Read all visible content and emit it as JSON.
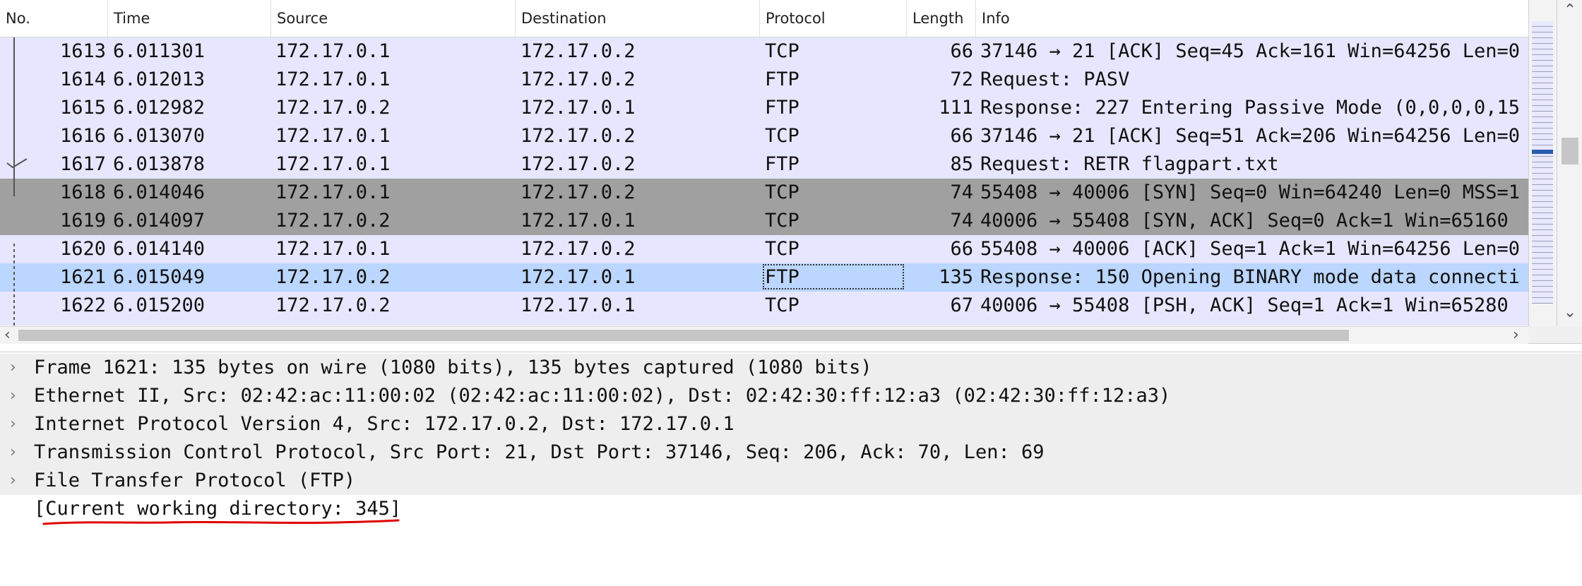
{
  "columns": {
    "no": "No.",
    "time": "Time",
    "source": "Source",
    "destination": "Destination",
    "protocol": "Protocol",
    "length": "Length",
    "info": "Info"
  },
  "packets": [
    {
      "no": "1613",
      "time": "6.011301",
      "src": "172.17.0.1",
      "dst": "172.17.0.2",
      "proto": "TCP",
      "len": "66",
      "info": "37146 → 21 [ACK] Seq=45 Ack=161 Win=64256 Len=0"
    },
    {
      "no": "1614",
      "time": "6.012013",
      "src": "172.17.0.1",
      "dst": "172.17.0.2",
      "proto": "FTP",
      "len": "72",
      "info": "Request: PASV"
    },
    {
      "no": "1615",
      "time": "6.012982",
      "src": "172.17.0.2",
      "dst": "172.17.0.1",
      "proto": "FTP",
      "len": "111",
      "info": "Response: 227 Entering Passive Mode (0,0,0,0,15"
    },
    {
      "no": "1616",
      "time": "6.013070",
      "src": "172.17.0.1",
      "dst": "172.17.0.2",
      "proto": "TCP",
      "len": "66",
      "info": "37146 → 21 [ACK] Seq=51 Ack=206 Win=64256 Len=0"
    },
    {
      "no": "1617",
      "time": "6.013878",
      "src": "172.17.0.1",
      "dst": "172.17.0.2",
      "proto": "FTP",
      "len": "85",
      "info": "Request: RETR flagpart.txt"
    },
    {
      "no": "1618",
      "time": "6.014046",
      "src": "172.17.0.1",
      "dst": "172.17.0.2",
      "proto": "TCP",
      "len": "74",
      "info": "55408 → 40006 [SYN] Seq=0 Win=64240 Len=0 MSS=1"
    },
    {
      "no": "1619",
      "time": "6.014097",
      "src": "172.17.0.2",
      "dst": "172.17.0.1",
      "proto": "TCP",
      "len": "74",
      "info": "40006 → 55408 [SYN, ACK] Seq=0 Ack=1 Win=65160"
    },
    {
      "no": "1620",
      "time": "6.014140",
      "src": "172.17.0.1",
      "dst": "172.17.0.2",
      "proto": "TCP",
      "len": "66",
      "info": "55408 → 40006 [ACK] Seq=1 Ack=1 Win=64256 Len=0"
    },
    {
      "no": "1621",
      "time": "6.015049",
      "src": "172.17.0.2",
      "dst": "172.17.0.1",
      "proto": "FTP",
      "len": "135",
      "info": "Response: 150 Opening BINARY mode data connecti"
    },
    {
      "no": "1622",
      "time": "6.015200",
      "src": "172.17.0.2",
      "dst": "172.17.0.1",
      "proto": "TCP",
      "len": "67",
      "info": "40006 → 55408 [PSH, ACK] Seq=1 Ack=1 Win=65280"
    }
  ],
  "details": [
    {
      "text": "Frame 1621: 135 bytes on wire (1080 bits), 135 bytes captured (1080 bits)",
      "expandable": true
    },
    {
      "text": "Ethernet II, Src: 02:42:ac:11:00:02 (02:42:ac:11:00:02), Dst: 02:42:30:ff:12:a3 (02:42:30:ff:12:a3)",
      "expandable": true
    },
    {
      "text": "Internet Protocol Version 4, Src: 172.17.0.2, Dst: 172.17.0.1",
      "expandable": true
    },
    {
      "text": "Transmission Control Protocol, Src Port: 21, Dst Port: 37146, Seq: 206, Ack: 70, Len: 69",
      "expandable": true
    },
    {
      "text": "File Transfer Protocol (FTP)",
      "expandable": true
    },
    {
      "text": "[Current working directory: 345]",
      "expandable": false
    }
  ],
  "colors": {
    "row_default": "#e7e6ff",
    "row_syn": "#a0a0a0",
    "row_selected": "#bbd6ff",
    "annotation": "#e00000"
  },
  "icons": {
    "expand": "chevron-right-icon",
    "scroll_up": "chevron-up-icon",
    "scroll_down": "chevron-down-icon",
    "scroll_left": "chevron-left-icon",
    "scroll_right": "chevron-right-icon"
  }
}
